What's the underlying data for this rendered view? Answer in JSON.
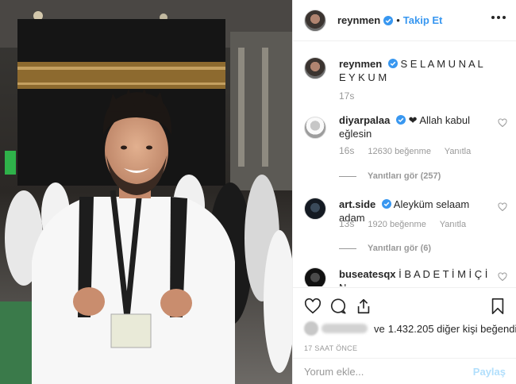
{
  "post": {
    "username": "reynmen",
    "separator": "•",
    "follow_label": "Takip Et"
  },
  "caption": {
    "username": "reynmen",
    "text": "S E L A M U N A L E Y K U M",
    "time": "17s"
  },
  "comments": [
    {
      "username": "diyarpalaa",
      "text": "❤ Allah kabul eğlesin",
      "time": "16s",
      "likes": "12630 beğenme",
      "reply_label": "Yanıtla",
      "view_replies": "Yanıtları gör (257)"
    },
    {
      "username": "art.side",
      "text": "Aleyküm selaam adam",
      "time": "13s",
      "likes": "1920 beğenme",
      "reply_label": "Yanıtla",
      "view_replies": "Yanıtları gör (6)"
    },
    {
      "username": "buseatesqx",
      "text": "İ B A D E T İ M İ Ç İ N"
    }
  ],
  "likes_summary": {
    "and_word": "ve",
    "rest": "1.432.205 diğer kişi beğendi"
  },
  "time_ago": "17 SAAT ÖNCE",
  "comment_input": {
    "placeholder": "Yorum ekle...",
    "share_label": "Paylaş"
  },
  "colors": {
    "accent": "#3897f0",
    "verified": "#3897f0",
    "muted": "#999999"
  },
  "icons": [
    "heart-icon",
    "comment-icon",
    "share-icon",
    "bookmark-icon",
    "more-icon",
    "verified-badge-icon"
  ]
}
